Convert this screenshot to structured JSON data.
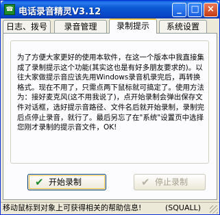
{
  "window": {
    "title": "电话录音精灵V3.12",
    "controls": {
      "minimize": "_",
      "maximize": "□",
      "close": "×"
    }
  },
  "tabs": [
    {
      "label": "日志、拨号",
      "active": false
    },
    {
      "label": "录音管理",
      "active": false
    },
    {
      "label": "录制提示",
      "active": true
    },
    {
      "label": "系统设置",
      "active": false
    }
  ],
  "panel": {
    "description": "为了方便大家更好的使用本软件，在这一个版本中我直接集成了录制提示这个功能(其实这也是有好多朋友要求的)。以往大家做提示音应该先用Windows录音机录完后，再转换格式。现在不用了，只需点两下鼠标就可搞定了。使用方法为：接好麦克风(这不用我说了)，点开始录制会弹出保存文件对话框，选好提示音路径、文件名后就开始录制，录制完后点停止录音，就行了。最后另忘了在\"系统\"设置页中选择您刚才录制的提示音文件，OK!"
  },
  "buttons": {
    "start": {
      "label": "开始录制",
      "icon": "check-icon",
      "enabled": true
    },
    "stop": {
      "label": "停止录制",
      "icon": "check-icon",
      "enabled": false
    }
  },
  "status": {
    "message": "移动鼠标到对象上可获得相关的帮助信息!",
    "credit": "(SQUALL)"
  },
  "colors": {
    "titlebar": "#0846c8",
    "accent_tab": "#ffc83c",
    "start_icon": "#1f8b2a"
  }
}
